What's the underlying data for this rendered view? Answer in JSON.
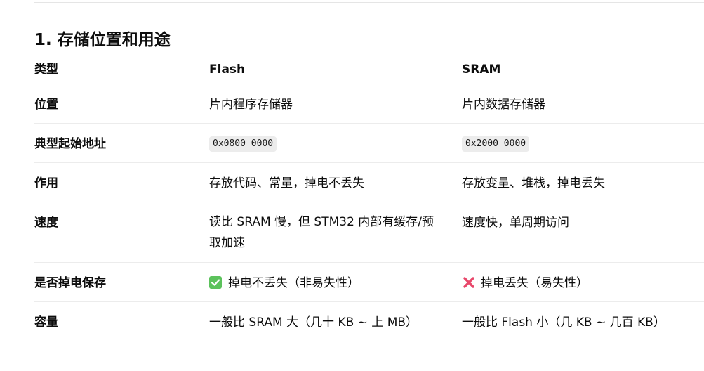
{
  "section": {
    "title": "1. 存储位置和用途"
  },
  "table": {
    "headers": [
      "类型",
      "Flash",
      "SRAM"
    ],
    "rows": [
      {
        "label": "位置",
        "flash": "片内程序存储器",
        "sram": "片内数据存储器"
      },
      {
        "label": "典型起始地址",
        "flash": "0x0800 0000",
        "sram": "0x2000 0000"
      },
      {
        "label": "作用",
        "flash": "存放代码、常量，掉电不丢失",
        "sram": "存放变量、堆栈，掉电丢失"
      },
      {
        "label": "速度",
        "flash": "读比 SRAM 慢，但 STM32 内部有缓存/预取加速",
        "sram": "速度快，单周期访问"
      },
      {
        "label": "是否掉电保存",
        "flash": "掉电不丢失（非易失性）",
        "sram": "掉电丢失（易失性）",
        "flash_icon": "check-mark-icon",
        "sram_icon": "cross-mark-icon"
      },
      {
        "label": "容量",
        "flash": "一般比 SRAM 大（几十 KB ~ 上 MB）",
        "sram": "一般比 Flash 小（几 KB ~ 几百 KB）"
      }
    ]
  },
  "colors": {
    "check_icon": "#5cc25c",
    "cross_icon": "#e8476a",
    "code_background": "#ececec"
  }
}
